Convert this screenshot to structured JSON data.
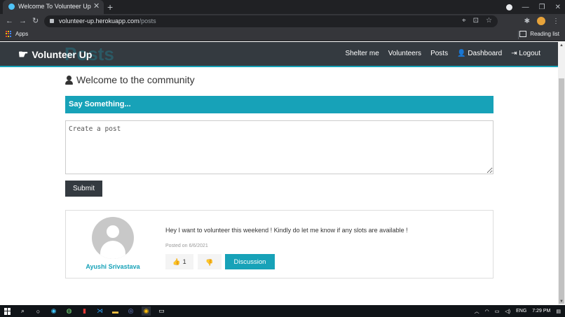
{
  "browser": {
    "tab_title": "Welcome To Volunteer Up",
    "tab_close": "✕",
    "new_tab": "+",
    "url_host": "volunteer-up.herokuapp.com",
    "url_path": "/posts",
    "bookmark_apps": "Apps",
    "reading_list": "Reading list"
  },
  "navbar": {
    "brand": "Volunteer Up",
    "ghost_text": "Posts",
    "links": [
      "Shelter me",
      "Volunteers",
      "Posts",
      "Dashboard",
      "Logout"
    ]
  },
  "page": {
    "welcome": "Welcome to the community",
    "say_header": "Say Something...",
    "post_placeholder": "Create a post",
    "submit_label": "Submit"
  },
  "posts": [
    {
      "author": "Ayushi Srivastava",
      "text": "Hey I want to volunteer this weekend ! Kindly do let me know if any slots are available !",
      "posted": "Posted on 6/6/2021",
      "likes": "1",
      "discussion_label": "Discussion"
    }
  ],
  "taskbar": {
    "lang": "ENG",
    "time": "7:29 PM"
  },
  "colors": {
    "accent": "#17a2b8",
    "navbar": "#343a40"
  }
}
